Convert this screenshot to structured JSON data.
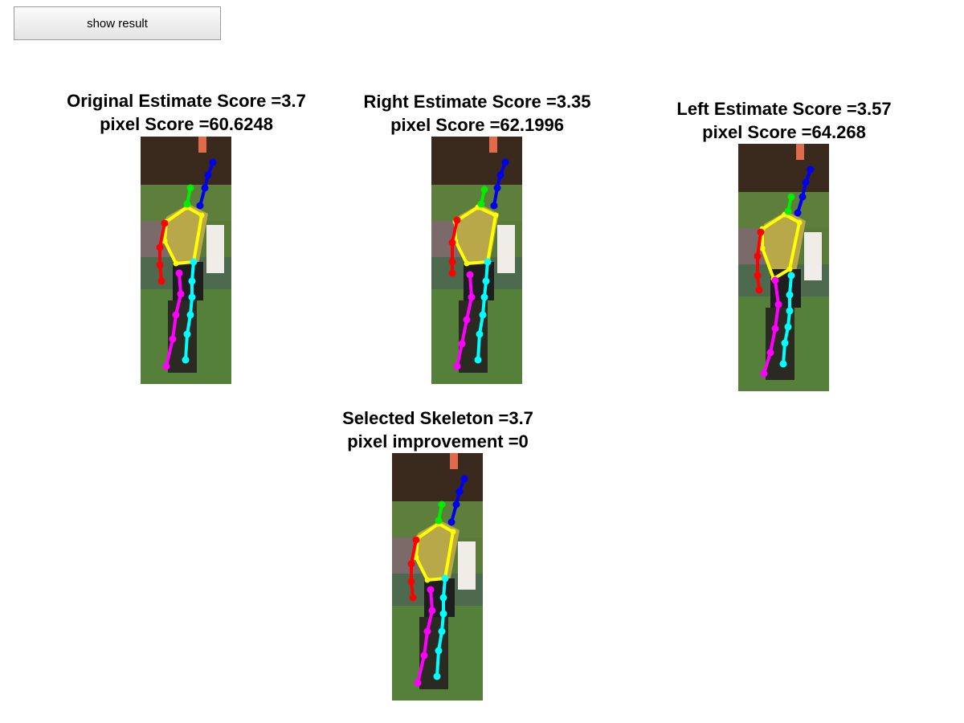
{
  "toolbar": {
    "show_result_label": "show result"
  },
  "panels": [
    {
      "id": "original",
      "title_line1": "Original Estimate Score =3.7",
      "title_line2": "pixel Score =60.6248"
    },
    {
      "id": "right",
      "title_line1": "Right Estimate Score =3.35",
      "title_line2": "pixel Score =62.1996"
    },
    {
      "id": "left",
      "title_line1": "Left Estimate Score =3.57",
      "title_line2": "pixel Score =64.268"
    },
    {
      "id": "selected",
      "title_line1": "Selected Skeleton =3.7",
      "title_line2": "pixel improvement =0"
    }
  ],
  "skeleton_colors": {
    "head": "#00ee00",
    "left_arm_raised": "#0000ee",
    "torso": "#ffff00",
    "right_arm": "#ff0000",
    "left_leg": "#ff00ff",
    "right_leg": "#00ffff"
  }
}
